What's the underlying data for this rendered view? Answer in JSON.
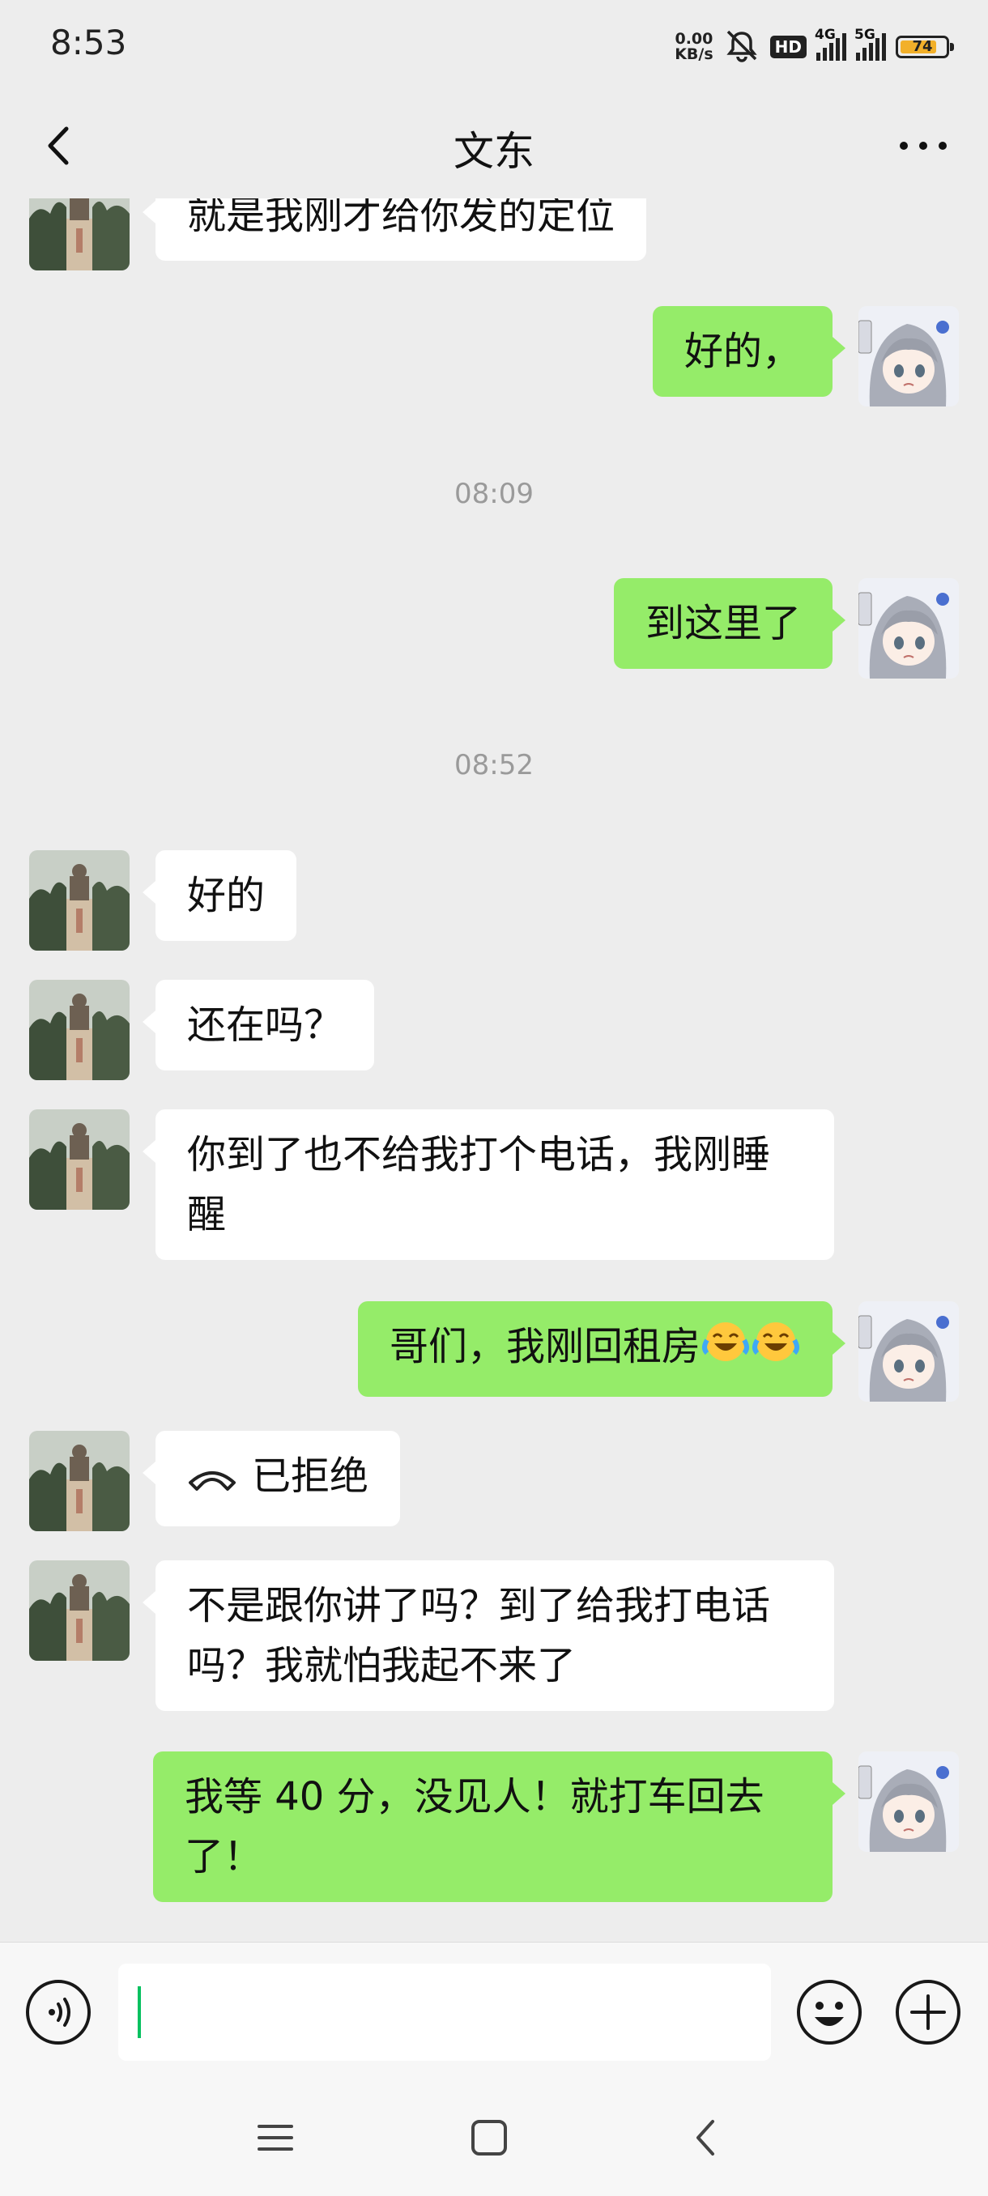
{
  "status_bar": {
    "time": "8:53",
    "net_speed_value": "0.00",
    "net_speed_unit": "KB/s",
    "hd_badge": "HD",
    "network_1": "4G",
    "network_2": "5G",
    "battery": "74"
  },
  "nav": {
    "title": "文东"
  },
  "messages": [
    {
      "side": "in",
      "text": "就是我刚才给你发的定位"
    },
    {
      "side": "out",
      "text": "好的，"
    },
    {
      "type": "time",
      "text": "08:09"
    },
    {
      "side": "out",
      "text": "到这里了"
    },
    {
      "type": "time",
      "text": "08:52"
    },
    {
      "side": "in",
      "text": "好的"
    },
    {
      "side": "in",
      "text": "还在吗？"
    },
    {
      "side": "in",
      "text": "你到了也不给我打个电话，我刚睡醒"
    },
    {
      "side": "out",
      "text": "哥们，我刚回租房",
      "emoji_count": 2,
      "emoji_name": "crying-laughing-emoji"
    },
    {
      "side": "in",
      "text": "已拒绝",
      "icon": "declined-call-icon"
    },
    {
      "side": "in",
      "text": "不是跟你讲了吗？到了给我打电话吗？我就怕我起不来了"
    },
    {
      "side": "out",
      "text": "我等 40 分，没见人！就打车回去了！"
    }
  ],
  "input": {
    "value": ""
  },
  "icons": {
    "voice": "voice-mode-icon",
    "emoji": "emoji-icon",
    "plus": "plus-icon",
    "menu": "menu-icon",
    "home": "home-square-icon",
    "back": "back-chevron-icon"
  },
  "colors": {
    "background": "#ededed",
    "outgoing_bubble": "#95ec69",
    "incoming_bubble": "#ffffff",
    "timestamp_text": "#9a9a9a",
    "caret": "#07c160"
  }
}
